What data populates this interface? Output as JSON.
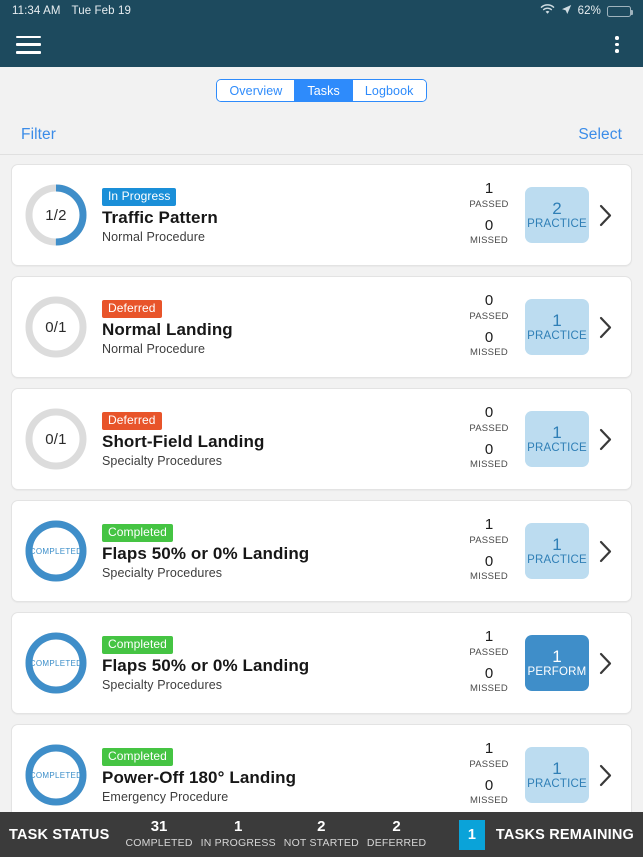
{
  "status_bar": {
    "time": "11:34 AM",
    "date": "Tue Feb 19",
    "battery_percent": "62%",
    "wifi_icon": "wifi-icon",
    "location_icon": "location-arrow-icon",
    "battery_icon": "battery-icon"
  },
  "navbar": {
    "menu_icon": "hamburger-menu-icon",
    "overflow_icon": "kebab-menu-icon",
    "background": "#1d4a5e"
  },
  "segmented": {
    "items": [
      {
        "label": "Overview",
        "active": false
      },
      {
        "label": "Tasks",
        "active": true
      },
      {
        "label": "Logbook",
        "active": false
      }
    ],
    "accent": "#2e8bfb"
  },
  "toolbar": {
    "filter_label": "Filter",
    "select_label": "Select",
    "link_color": "#3b8ce8"
  },
  "colors": {
    "badge_in_progress": "#1a8fd8",
    "badge_deferred": "#e8542a",
    "badge_completed": "#45c443",
    "ring_filled": "#3f8ec9",
    "ring_track": "#dcdcdc",
    "practice_bg": "#bcdcf0",
    "perform_bg": "#3f8ec9"
  },
  "tasks": [
    {
      "ring_text": "1/2",
      "ring_progress": 0.5,
      "ring_state": "partial",
      "badge": {
        "label": "In Progress",
        "type": "in_progress"
      },
      "title": "Traffic Pattern",
      "subtitle": "Normal Procedure",
      "passed": "1",
      "passed_label": "PASSED",
      "missed": "0",
      "missed_label": "MISSED",
      "action": {
        "count": "2",
        "label": "PRACTICE",
        "type": "practice"
      }
    },
    {
      "ring_text": "0/1",
      "ring_progress": 0,
      "ring_state": "empty",
      "badge": {
        "label": "Deferred",
        "type": "deferred"
      },
      "title": "Normal Landing",
      "subtitle": "Normal Procedure",
      "passed": "0",
      "passed_label": "PASSED",
      "missed": "0",
      "missed_label": "MISSED",
      "action": {
        "count": "1",
        "label": "PRACTICE",
        "type": "practice"
      }
    },
    {
      "ring_text": "0/1",
      "ring_progress": 0,
      "ring_state": "empty",
      "badge": {
        "label": "Deferred",
        "type": "deferred"
      },
      "title": "Short-Field Landing",
      "subtitle": "Specialty Procedures",
      "passed": "0",
      "passed_label": "PASSED",
      "missed": "0",
      "missed_label": "MISSED",
      "action": {
        "count": "1",
        "label": "PRACTICE",
        "type": "practice"
      }
    },
    {
      "ring_text": "COMPLETED",
      "ring_progress": 1,
      "ring_state": "complete",
      "badge": {
        "label": "Completed",
        "type": "completed"
      },
      "title": "Flaps 50% or 0% Landing",
      "subtitle": "Specialty Procedures",
      "passed": "1",
      "passed_label": "PASSED",
      "missed": "0",
      "missed_label": "MISSED",
      "action": {
        "count": "1",
        "label": "PRACTICE",
        "type": "practice"
      }
    },
    {
      "ring_text": "COMPLETED",
      "ring_progress": 1,
      "ring_state": "complete",
      "badge": {
        "label": "Completed",
        "type": "completed"
      },
      "title": "Flaps 50% or 0% Landing",
      "subtitle": "Specialty Procedures",
      "passed": "1",
      "passed_label": "PASSED",
      "missed": "0",
      "missed_label": "MISSED",
      "action": {
        "count": "1",
        "label": "PERFORM",
        "type": "perform"
      }
    },
    {
      "ring_text": "COMPLETED",
      "ring_progress": 1,
      "ring_state": "complete",
      "badge": {
        "label": "Completed",
        "type": "completed"
      },
      "title": "Power-Off 180° Landing",
      "subtitle": "Emergency Procedure",
      "passed": "1",
      "passed_label": "PASSED",
      "missed": "0",
      "missed_label": "MISSED",
      "action": {
        "count": "1",
        "label": "PRACTICE",
        "type": "practice"
      }
    }
  ],
  "bottom_bar": {
    "title": "TASK STATUS",
    "stats": [
      {
        "num": "31",
        "cap": "COMPLETED"
      },
      {
        "num": "1",
        "cap": "IN PROGRESS"
      },
      {
        "num": "2",
        "cap": "NOT STARTED"
      },
      {
        "num": "2",
        "cap": "DEFERRED"
      }
    ],
    "remaining_count": "1",
    "remaining_label": "TASKS REMAINING",
    "badge_color": "#0aa3d9"
  }
}
